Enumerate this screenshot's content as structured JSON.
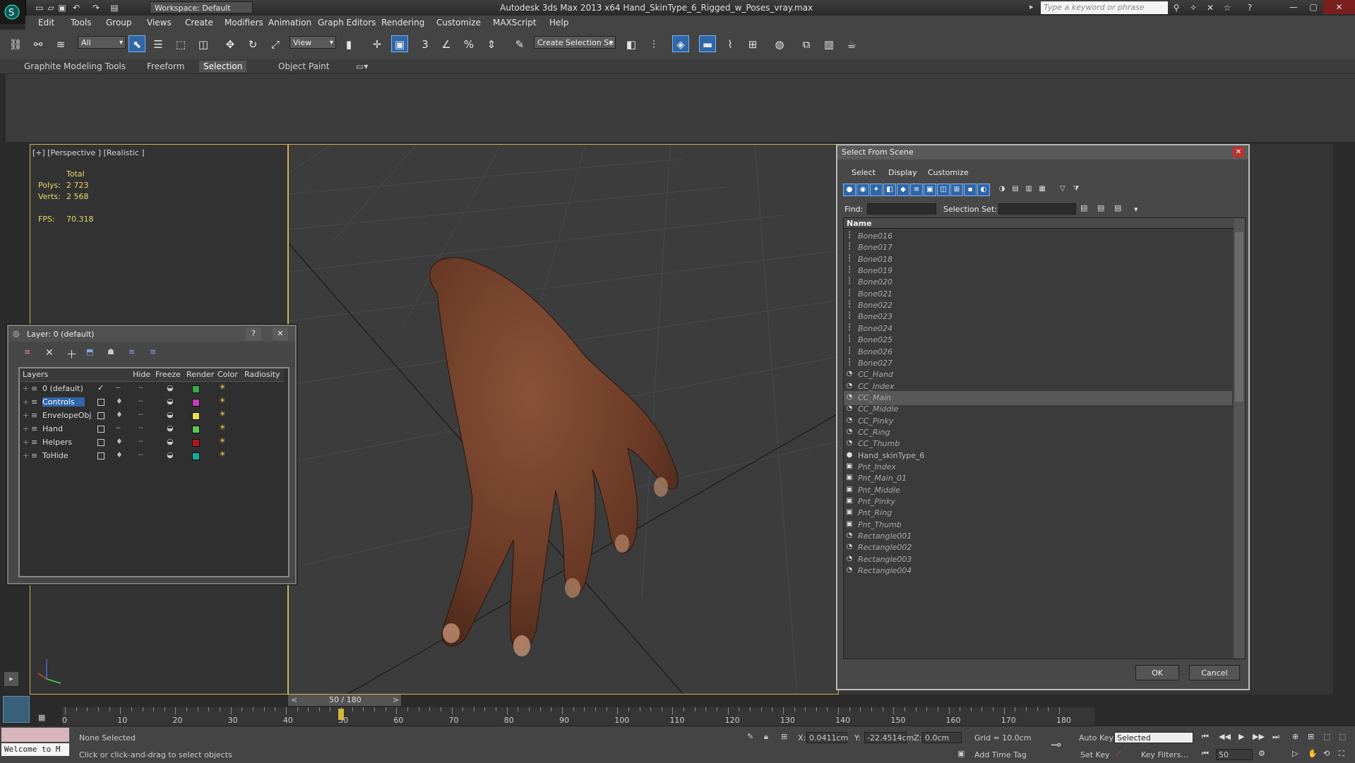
{
  "titlebar": {
    "workspace": "Workspace: Default",
    "title": "Autodesk 3ds Max  2013 x64      Hand_SkinType_6_Rigged_w_Poses_vray.max",
    "search_placeholder": "Type a keyword or phrase"
  },
  "menu": [
    "Edit",
    "Tools",
    "Group",
    "Views",
    "Create",
    "Modifiers",
    "Animation",
    "Graph Editors",
    "Rendering",
    "Customize",
    "MAXScript",
    "Help"
  ],
  "toolbar": {
    "filter": "All",
    "ref_coord": "View",
    "named_selection": "Create Selection Se",
    "snap_3": "3",
    "percent_snap": "%"
  },
  "ribbon": {
    "tabs": [
      "Graphite Modeling Tools",
      "Freeform",
      "Selection",
      "Object Paint"
    ],
    "active_tab": "Selection"
  },
  "viewport": {
    "label": "[+] [Perspective ] [Realistic ]",
    "stats_header": "Total",
    "polys_label": "Polys:",
    "polys": "2 723",
    "verts_label": "Verts:",
    "verts": "2 568",
    "fps_label": "FPS:",
    "fps": "70.318"
  },
  "layer_dialog": {
    "title": "Layer: 0 (default)",
    "help": "?",
    "close": "✕",
    "columns": [
      "Layers",
      "Hide",
      "Freeze",
      "Render",
      "Color",
      "Radiosity"
    ],
    "layers": [
      {
        "name": "0 (default)",
        "color": "#3aa84a",
        "current": true
      },
      {
        "name": "Controls",
        "color": "#c23fb4",
        "selected": true
      },
      {
        "name": "EnvelopeObj",
        "color": "#e6e05a"
      },
      {
        "name": "Hand",
        "color": "#5cc85c"
      },
      {
        "name": "Helpers",
        "color": "#b01818"
      },
      {
        "name": "ToHide",
        "color": "#18a8a0"
      }
    ]
  },
  "select_dialog": {
    "title": "Select From Scene",
    "menu": [
      "Select",
      "Display",
      "Customize"
    ],
    "find_label": "Find:",
    "selection_set_label": "Selection Set:",
    "name_header": "Name",
    "items": [
      {
        "name": "Bone016",
        "type": "bone"
      },
      {
        "name": "Bone017",
        "type": "bone"
      },
      {
        "name": "Bone018",
        "type": "bone"
      },
      {
        "name": "Bone019",
        "type": "bone"
      },
      {
        "name": "Bone020",
        "type": "bone"
      },
      {
        "name": "Bone021",
        "type": "bone"
      },
      {
        "name": "Bone022",
        "type": "bone"
      },
      {
        "name": "Bone023",
        "type": "bone"
      },
      {
        "name": "Bone024",
        "type": "bone"
      },
      {
        "name": "Bone025",
        "type": "bone"
      },
      {
        "name": "Bone026",
        "type": "bone"
      },
      {
        "name": "Bone027",
        "type": "bone"
      },
      {
        "name": "CC_Hand",
        "type": "shape"
      },
      {
        "name": "CC_Index",
        "type": "shape"
      },
      {
        "name": "CC_Main",
        "type": "shape",
        "highlight": true
      },
      {
        "name": "CC_Middle",
        "type": "shape"
      },
      {
        "name": "CC_Pinky",
        "type": "shape"
      },
      {
        "name": "CC_Ring",
        "type": "shape"
      },
      {
        "name": "CC_Thumb",
        "type": "shape"
      },
      {
        "name": "Hand_skinType_6",
        "type": "geometry",
        "plain": true
      },
      {
        "name": "Pnt_Index",
        "type": "helper"
      },
      {
        "name": "Pnt_Main_01",
        "type": "helper"
      },
      {
        "name": "Pnt_Middle",
        "type": "helper"
      },
      {
        "name": "Pnt_Pinky",
        "type": "helper"
      },
      {
        "name": "Pnt_Ring",
        "type": "helper"
      },
      {
        "name": "Pnt_Thumb",
        "type": "helper"
      },
      {
        "name": "Rectangle001",
        "type": "shape"
      },
      {
        "name": "Rectangle002",
        "type": "shape"
      },
      {
        "name": "Rectangle003",
        "type": "shape"
      },
      {
        "name": "Rectangle004",
        "type": "shape"
      }
    ],
    "ok": "OK",
    "cancel": "Cancel"
  },
  "timeline": {
    "frame_display": "50 / 180",
    "current_frame": 50,
    "total_frames": 180,
    "ticks": [
      "0",
      "10",
      "20",
      "30",
      "40",
      "50",
      "60",
      "70",
      "80",
      "90",
      "100",
      "110",
      "120",
      "130",
      "140",
      "150",
      "160",
      "170",
      "180"
    ]
  },
  "status": {
    "maxscript": "Welcome to M",
    "selection": "None Selected",
    "prompt": "Click or click-and-drag to select objects",
    "x_label": "X:",
    "x": "0.0411cm",
    "y_label": "Y:",
    "y": "-22.4514cm",
    "z_label": "Z:",
    "z": "0.0cm",
    "grid": "Grid = 10.0cm",
    "add_time_tag": "Add Time Tag",
    "auto_key": "Auto Key",
    "set_key": "Set Key",
    "key_mode": "Selected",
    "key_filters": "Key Filters...",
    "frame_field": "50"
  }
}
